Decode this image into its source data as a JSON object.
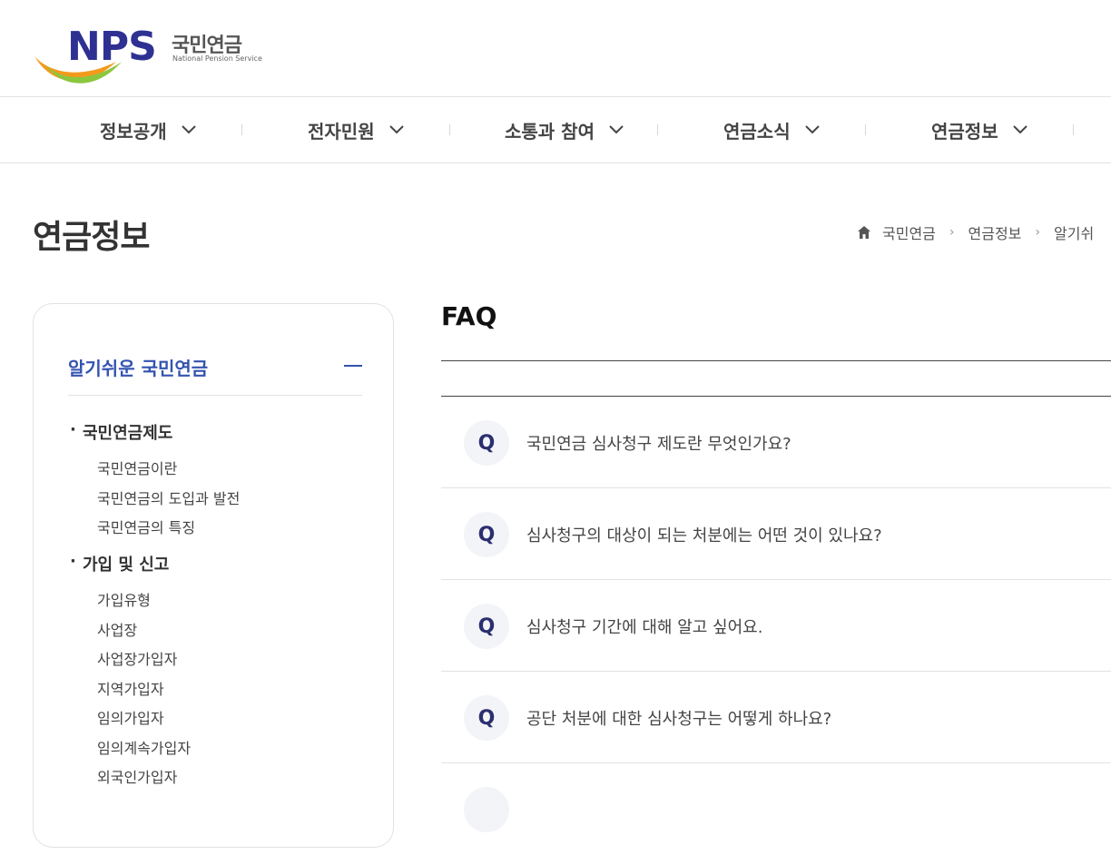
{
  "logo": {
    "brand": "NPS",
    "korean_name": "국민연금",
    "english_name": "National Pension Service"
  },
  "gnb": [
    {
      "label": "정보공개"
    },
    {
      "label": "전자민원"
    },
    {
      "label": "소통과 참여"
    },
    {
      "label": "연금소식"
    },
    {
      "label": "연금정보"
    }
  ],
  "page_title": "연금정보",
  "breadcrumb": {
    "items": [
      "국민연금",
      "연금정보",
      "알기쉬"
    ]
  },
  "side_menu": {
    "header": "알기쉬운 국민연금",
    "groups": [
      {
        "title": "국민연금제도",
        "items": [
          "국민연금이란",
          "국민연금의 도입과 발전",
          "국민연금의 특징"
        ]
      },
      {
        "title": "가입 및 신고",
        "items": [
          "가입유형",
          "사업장",
          "사업장가입자",
          "지역가입자",
          "임의가입자",
          "임의계속가입자",
          "외국인가입자"
        ]
      }
    ]
  },
  "content": {
    "title": "FAQ",
    "q_marker": "Q",
    "faqs": [
      "국민연금 심사청구 제도란 무엇인가요?",
      "심사청구의 대상이 되는 처분에는 어떤 것이 있나요?",
      "심사청구 기간에 대해 알고 싶어요.",
      "공단 처분에 대한 심사청구는 어떻게 하나요?"
    ]
  },
  "colors": {
    "accent": "#3453b0",
    "logo_blue": "#2e3192",
    "q_text": "#2b2f6e"
  },
  "icons": {
    "breadcrumb_home": "home-icon",
    "breadcrumb_sep": "chevron-right-icon",
    "gnb_toggle": "chevron-down-icon",
    "side_toggle": "minus-icon"
  }
}
